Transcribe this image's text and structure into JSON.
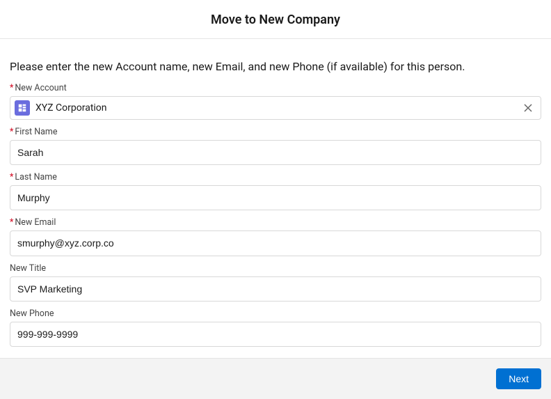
{
  "header": {
    "title": "Move to New Company"
  },
  "description": "Please enter the new Account name, new Email, and new Phone (if available) for this person.",
  "fields": {
    "new_account": {
      "label": "New Account",
      "value": "XYZ Corporation",
      "required": true
    },
    "first_name": {
      "label": "First Name",
      "value": "Sarah",
      "required": true
    },
    "last_name": {
      "label": "Last Name",
      "value": "Murphy",
      "required": true
    },
    "new_email": {
      "label": "New Email",
      "value": "smurphy@xyz.corp.co",
      "required": true
    },
    "new_title": {
      "label": "New Title",
      "value": "SVP Marketing",
      "required": false
    },
    "new_phone": {
      "label": "New Phone",
      "value": "999-999-9999",
      "required": false
    }
  },
  "footer": {
    "next_label": "Next"
  }
}
